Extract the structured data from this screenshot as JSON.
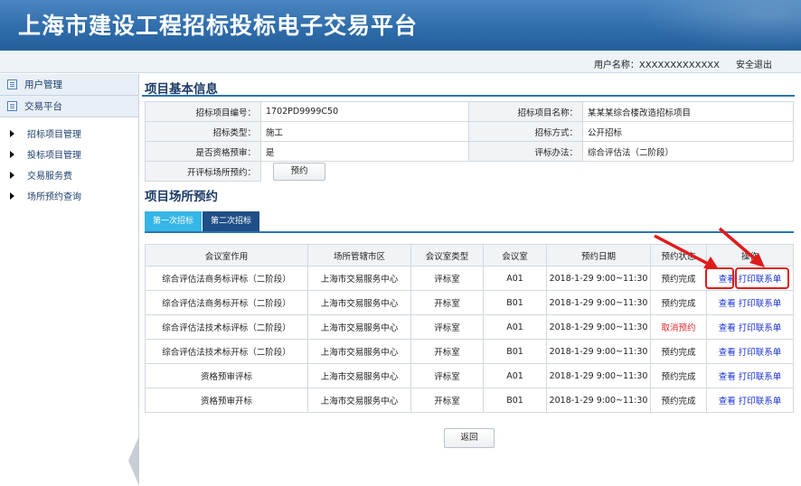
{
  "header": {
    "title": "上海市建设工程招标投标电子交易平台"
  },
  "userbar": {
    "user_label": "用户名称：XXXXXXXXXXXXX",
    "logout": "安全退出"
  },
  "sidebar": {
    "sections": [
      {
        "label": "用户管理"
      },
      {
        "label": "交易平台"
      }
    ],
    "items": [
      {
        "label": "招标项目管理"
      },
      {
        "label": "投标项目管理"
      },
      {
        "label": "交易服务费"
      },
      {
        "label": "场所预约查询"
      }
    ]
  },
  "basic_info": {
    "title": "项目基本信息",
    "project_no_label": "招标项目编号：",
    "project_no": "1702PD9999C50",
    "project_name_label": "招标项目名称：",
    "project_name": "某某某综合楼改造招标项目",
    "bid_type_label": "招标类型：",
    "bid_type": "施工",
    "bid_method_label": "招标方式：",
    "bid_method": "公开招标",
    "prequal_label": "是否资格预审：",
    "prequal": "是",
    "eval_method_label": "评标办法：",
    "eval_method": "综合评估法（二阶段）",
    "venue_label": "开评标场所预约：",
    "venue_button": "预约"
  },
  "reservation": {
    "title": "项目场所预约",
    "tabs": [
      {
        "label": "第一次招标"
      },
      {
        "label": "第二次招标"
      }
    ],
    "columns": [
      "会议室作用",
      "场所管辖市区",
      "会议室类型",
      "会议室",
      "预约日期",
      "预约状态",
      "操作"
    ],
    "rows": [
      {
        "purpose": "综合评估法商务标评标（二阶段）",
        "district": "上海市交易服务中心",
        "room_type": "评标室",
        "room": "A01",
        "date": "2018-1-29 9:00~11:30",
        "status": "预约完成",
        "view": "查看",
        "print": "打印联系单"
      },
      {
        "purpose": "综合评估法商务标开标（二阶段）",
        "district": "上海市交易服务中心",
        "room_type": "开标室",
        "room": "B01",
        "date": "2018-1-29 9:00~11:30",
        "status": "预约完成",
        "view": "查看",
        "print": "打印联系单"
      },
      {
        "purpose": "综合评估法技术标评标（二阶段）",
        "district": "上海市交易服务中心",
        "room_type": "评标室",
        "room": "A01",
        "date": "2018-1-29 9:00~11:30",
        "status": "取消预约",
        "view": "查看",
        "print": "打印联系单"
      },
      {
        "purpose": "综合评估法技术标开标（二阶段）",
        "district": "上海市交易服务中心",
        "room_type": "开标室",
        "room": "B01",
        "date": "2018-1-29 9:00~11:30",
        "status": "预约完成",
        "view": "查看",
        "print": "打印联系单"
      },
      {
        "purpose": "资格预审评标",
        "district": "上海市交易服务中心",
        "room_type": "评标室",
        "room": "A01",
        "date": "2018-1-29 9:00~11:30",
        "status": "预约完成",
        "view": "查看",
        "print": "打印联系单"
      },
      {
        "purpose": "资格预审开标",
        "district": "上海市交易服务中心",
        "room_type": "开标室",
        "room": "B01",
        "date": "2018-1-29 9:00~11:30",
        "status": "预约完成",
        "view": "查看",
        "print": "打印联系单"
      }
    ],
    "back_button": "返回"
  },
  "colors": {
    "header": "#2f6dab",
    "accent": "#2c73b5",
    "tab_active": "#35b6e6",
    "tab_other": "#1e4f86",
    "link": "#1a32d4",
    "cancel": "#e4262b",
    "annotation": "#e11a1a"
  }
}
